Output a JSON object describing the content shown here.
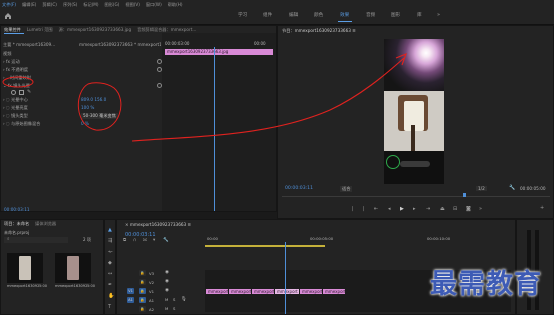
{
  "menu": [
    "文件(F)",
    "编辑(E)",
    "剪辑(C)",
    "序列(S)",
    "标记(M)",
    "图形(G)",
    "视图(V)",
    "窗口(W)",
    "帮助(H)"
  ],
  "workspaces": {
    "home_icon": "home-icon",
    "tabs": [
      "学习",
      "组件",
      "编辑",
      "颜色",
      "效果",
      "音频",
      "图形",
      "库"
    ],
    "active": "效果"
  },
  "effect_controls": {
    "tabs": [
      "效果控件",
      "Lumetri 范围",
      "源：mmexport1630923733663.jpg",
      "音频剪辑混合器：mmexport..."
    ],
    "source_label": "主要 * mmexport16309...",
    "clip_label": "mmexport163092373663 * mmexport163...",
    "section": "视频",
    "effects": [
      "运动",
      "不透明度",
      "时间重映射",
      "镜头光晕"
    ],
    "props": [
      {
        "label": "光晕中心",
        "value": "809.0   156.0"
      },
      {
        "label": "光晕亮度",
        "value": "100 %"
      },
      {
        "label": "镜头类型",
        "value": "50-300 毫米变焦"
      },
      {
        "label": "与原始图像混合",
        "value": "0 %"
      }
    ],
    "mini_timecode_start": "00:00:03:00",
    "mini_timecode_end": "00:00",
    "mini_clip": "mmexport1630923733663.jpg",
    "bottom_timecode": "00:00:03:11"
  },
  "program": {
    "title": "节目：mmexport1630923733663 ≡",
    "timecode": "00:00:03:11",
    "fit": "适合",
    "fraction": "1/2",
    "end_timecode": "00:00:05:00"
  },
  "project": {
    "tabs": [
      "项目：未命名",
      "媒体浏览器"
    ],
    "file": "未命名.prproj",
    "item_count": "2 项",
    "items": [
      {
        "name": "mmexport1630923733663...",
        "dur": "5:00"
      },
      {
        "name": "mmexport1630923733663",
        "dur": "5:00"
      }
    ]
  },
  "timeline": {
    "title": "mmexport1630923733663",
    "timecode": "00:00:03:11",
    "ruler": [
      "00:00",
      "00:00:05:00",
      "00:00:10:00"
    ],
    "tracks": [
      {
        "a": "6",
        "name": "V3"
      },
      {
        "a": "6",
        "name": "V2"
      },
      {
        "a": "V1",
        "name": "V1"
      },
      {
        "a": "A1",
        "name": "A1"
      },
      {
        "a": "6",
        "name": "A2"
      },
      {
        "a": "6",
        "name": "A3"
      }
    ],
    "clips": [
      "mmexport",
      "mmexport",
      "mmexport",
      "mmexport",
      "mmexport",
      "mmexport"
    ]
  },
  "watermark": "最需教育",
  "colors": {
    "accent": "#5b9ee6",
    "clip": "#d98ad6",
    "annotation": "#e0221f",
    "playhead": "#4f8fd8"
  }
}
